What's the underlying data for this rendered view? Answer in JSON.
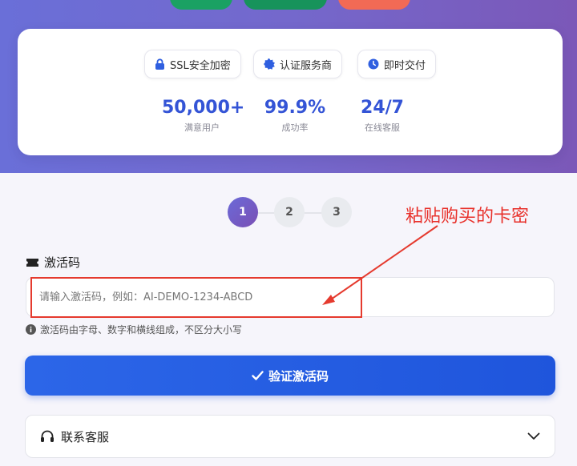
{
  "stats_card": {
    "badges": [
      {
        "icon": "lock-icon",
        "label": "SSL安全加密"
      },
      {
        "icon": "verified-badge-icon",
        "label": "认证服务商"
      },
      {
        "icon": "clock-icon",
        "label": "即时交付"
      }
    ],
    "stats": [
      {
        "value": "50,000+",
        "label": "满意用户"
      },
      {
        "value": "99.9%",
        "label": "成功率"
      },
      {
        "value": "24/7",
        "label": "在线客服"
      }
    ]
  },
  "steps": [
    "1",
    "2",
    "3"
  ],
  "annotation": {
    "text": "粘贴购买的卡密",
    "color": "#e8302a"
  },
  "activation": {
    "label": "激活码",
    "placeholder": "请输入激活码，例如：AI-DEMO-1234-ABCD",
    "hint": "激活码由字母、数字和横线组成，不区分大小写"
  },
  "verify_button": {
    "label": "验证激活码"
  },
  "support": {
    "label": "联系客服"
  },
  "colors": {
    "accent": "#2c66e8",
    "stat_value": "#3454d6",
    "annotation_red": "#e53a2e"
  }
}
